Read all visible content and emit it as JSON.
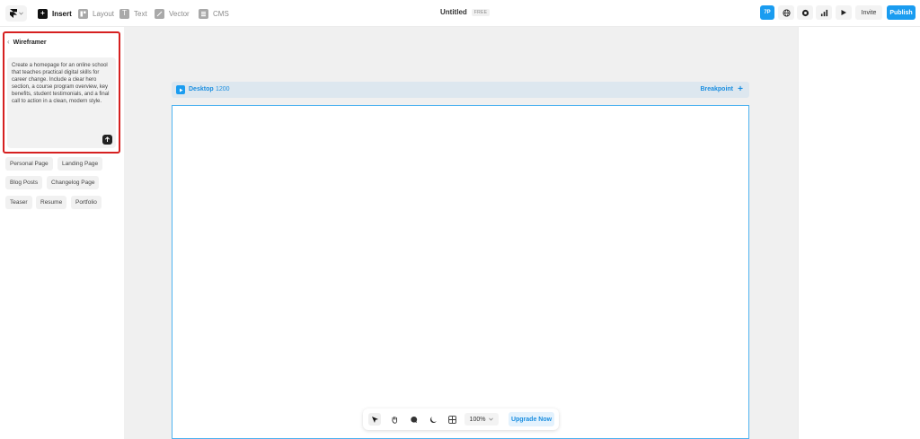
{
  "topbar": {
    "logo_icon": "framer-logo-icon",
    "tools": [
      {
        "label": "Insert",
        "icon": "plus-icon",
        "active": true
      },
      {
        "label": "Layout",
        "icon": "layout-icon",
        "active": false
      },
      {
        "label": "Text",
        "icon": "text-icon",
        "active": false
      },
      {
        "label": "Vector",
        "icon": "pen-icon",
        "active": false
      },
      {
        "label": "CMS",
        "icon": "database-icon",
        "active": false
      }
    ],
    "document_title": "Untitled",
    "plan_badge": "FREE",
    "avatar_initials": "7P",
    "right_icons": [
      "globe-icon",
      "settings-icon",
      "analytics-icon",
      "play-icon"
    ],
    "invite_label": "Invite",
    "publish_label": "Publish"
  },
  "left_panel": {
    "wireframer_title": "Wireframer",
    "prompt_text": "Create a homepage for an online school that teaches practical digital skills for career change. Include a clear hero section, a course program overview, key benefits, student testimonials, and a final call to action in a clean, modern style.",
    "suggestions": [
      "Personal Page",
      "Landing Page",
      "Blog Posts",
      "Changelog Page",
      "Teaser",
      "Resume",
      "Portfolio"
    ]
  },
  "canvas": {
    "breakpoint_name": "Desktop",
    "breakpoint_width": "1200",
    "breakpoint_label": "Breakpoint"
  },
  "bottom_toolbar": {
    "tools": [
      "select-arrow-icon",
      "hand-icon",
      "comment-icon",
      "dark-mode-icon",
      "grid-icon"
    ],
    "zoom": "100%",
    "upgrade_label": "Upgrade Now"
  },
  "colors": {
    "accent": "#1a9cf0",
    "highlight_border": "#d62020",
    "frame_border": "#4db2f0"
  }
}
